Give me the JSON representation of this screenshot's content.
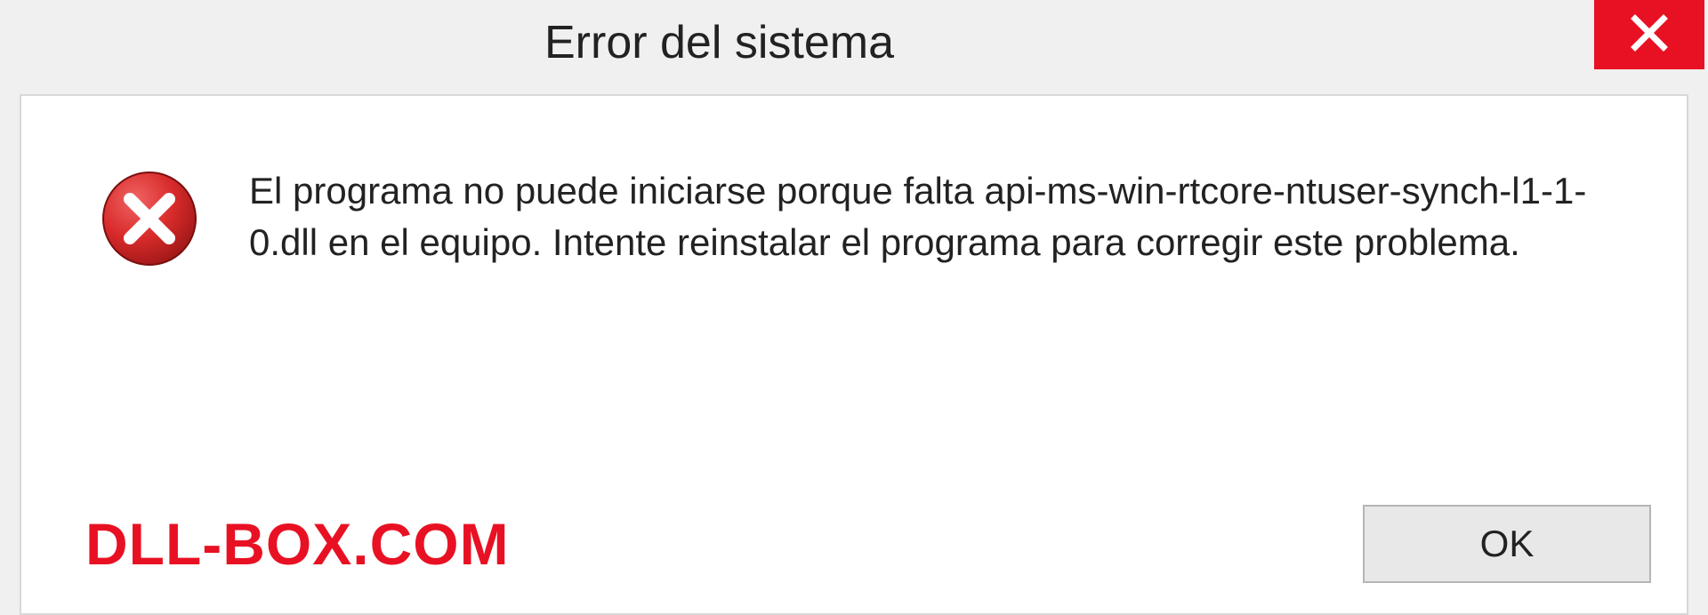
{
  "titlebar": {
    "title": "Error del sistema"
  },
  "dialog": {
    "message": "El programa no puede iniciarse porque falta api-ms-win-rtcore-ntuser-synch-l1-1-0.dll en el equipo. Intente reinstalar el programa para corregir este problema."
  },
  "footer": {
    "watermark": "DLL-BOX.COM",
    "ok_label": "OK"
  },
  "icons": {
    "close": "close-icon",
    "error": "error-icon"
  },
  "colors": {
    "close_bg": "#e81123",
    "watermark": "#e81123",
    "error_circle": "#d92b2b"
  }
}
